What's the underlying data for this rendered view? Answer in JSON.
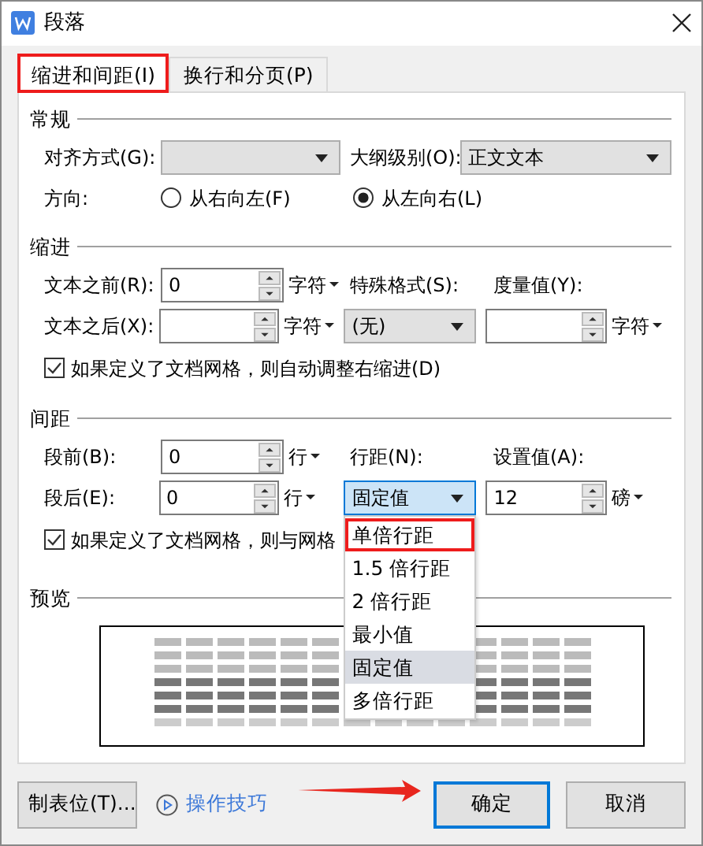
{
  "window": {
    "title": "段落"
  },
  "tabs": [
    {
      "label": "缩进和间距(I)",
      "selected": true,
      "highlighted": true
    },
    {
      "label": "换行和分页(P)",
      "selected": false,
      "highlighted": false
    }
  ],
  "sections": [
    {
      "title": "常规",
      "rows": [
        [
          {
            "kind": "label",
            "text": "对齐方式(G):"
          },
          {
            "kind": "long-select"
          },
          {
            "kind": "inline-label",
            "text": "大纲级别(O):"
          },
          {
            "kind": "long-select",
            "value": "正文文本"
          }
        ],
        [
          {
            "kind": "label",
            "text": "方向:"
          },
          {
            "kind": "radio",
            "text": "从右向左(F)",
            "selected": false
          },
          {
            "kind": "radio",
            "text": "从左向右(L)",
            "selected": true
          }
        ]
      ]
    },
    {
      "title": "缩进",
      "rows": [
        [
          {
            "kind": "label",
            "text": "文本之前(R):"
          },
          {
            "kind": "spin",
            "value": "0"
          },
          {
            "kind": "unit",
            "text": "字符"
          },
          {
            "kind": "caption",
            "text": "特殊格式(S):"
          },
          {
            "kind": "caption",
            "text": "度量值(Y):"
          }
        ],
        [
          {
            "kind": "label",
            "text": "文本之后(X):"
          },
          {
            "kind": "spin"
          },
          {
            "kind": "unit",
            "text": "字符"
          },
          {
            "kind": "select",
            "value": "(无)",
            "focused": false
          },
          {
            "kind": "spin"
          },
          {
            "kind": "unit",
            "text": "字符"
          }
        ],
        [
          {
            "kind": "check",
            "text": "如果定义了文档网格，则自动调整右缩进(D)",
            "checked": true
          }
        ]
      ]
    },
    {
      "title": "间距",
      "rows": [
        [
          {
            "kind": "label",
            "text": "段前(B):"
          },
          {
            "kind": "spin",
            "value": "0"
          },
          {
            "kind": "unit",
            "text": "行"
          },
          {
            "kind": "caption",
            "text": "行距(N):"
          },
          {
            "kind": "caption",
            "text": "设置值(A):"
          }
        ],
        [
          {
            "kind": "label",
            "text": "段后(E):"
          },
          {
            "kind": "spin",
            "value": "0"
          },
          {
            "kind": "unit",
            "text": "行"
          },
          {
            "kind": "select",
            "value": "固定值",
            "focused": true,
            "open": true,
            "options": [
              {
                "label": "单倍行距",
                "selected": false,
                "highlighted": true
              },
              {
                "label": "1.5 倍行距",
                "selected": false,
                "highlighted": false
              },
              {
                "label": "2 倍行距",
                "selected": false,
                "highlighted": false
              },
              {
                "label": "最小值",
                "selected": false,
                "highlighted": false
              },
              {
                "label": "固定值",
                "selected": true,
                "highlighted": false
              },
              {
                "label": "多倍行距",
                "selected": false,
                "highlighted": false
              }
            ]
          },
          {
            "kind": "spin",
            "value": "12"
          },
          {
            "kind": "unit",
            "text": "磅"
          }
        ],
        [
          {
            "kind": "check",
            "text": "如果定义了文档网格，则与网格",
            "checked": true
          }
        ]
      ]
    },
    {
      "title": "预览",
      "rows": [
        [
          {
            "kind": "preview"
          }
        ]
      ]
    }
  ],
  "footer": {
    "tabs_button": "制表位(T)...",
    "tips_link": "操作技巧",
    "buttons": [
      {
        "label": "确定",
        "default": true,
        "pointed": true
      },
      {
        "label": "取消",
        "default": false
      }
    ]
  }
}
